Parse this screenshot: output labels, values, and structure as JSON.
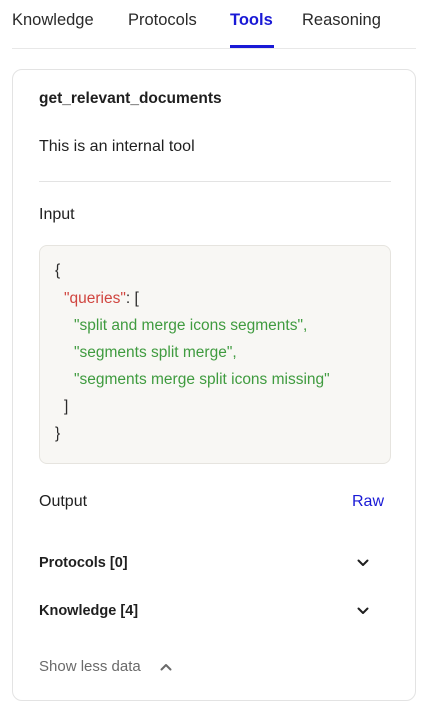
{
  "tabs": [
    {
      "label": "Knowledge",
      "active": false
    },
    {
      "label": "Protocols",
      "active": false
    },
    {
      "label": "Tools",
      "active": true
    },
    {
      "label": "Reasoning",
      "active": false
    }
  ],
  "accent_color": "#1a1ad6",
  "tool": {
    "name": "get_relevant_documents",
    "description": "This is an internal tool"
  },
  "input": {
    "label": "Input",
    "code": {
      "open_brace": "{",
      "key": "\"queries\"",
      "key_suffix": ": [",
      "items": [
        "\"split and merge icons segments\",",
        "\"segments split merge\",",
        "\"segments merge split icons missing\""
      ],
      "close_bracket": "]",
      "close_brace": "}"
    }
  },
  "output": {
    "label": "Output",
    "raw_label": "Raw",
    "sections": [
      {
        "label": "Protocols [0]",
        "icon": "chevron-down-icon"
      },
      {
        "label": "Knowledge [4]",
        "icon": "chevron-down-icon"
      }
    ]
  },
  "footer": {
    "show_less_label": "Show less data",
    "icon": "chevron-up-icon"
  }
}
